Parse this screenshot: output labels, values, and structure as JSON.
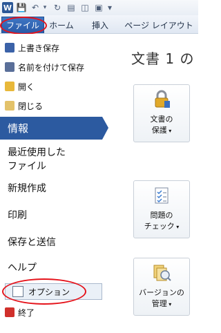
{
  "toolbar": {
    "app_icon": "W",
    "save_icon": "💾",
    "undo_icon": "↶",
    "redo_icon": "↻",
    "extra_icon": "▾"
  },
  "tabs": {
    "file": "ファイル",
    "home": "ホーム",
    "insert": "挿入",
    "page_layout": "ページ レイアウト"
  },
  "menu": {
    "overwrite_save": "上書き保存",
    "save_as": "名前を付けて保存",
    "open": "開く",
    "close": "閉じる",
    "info": "情報",
    "recent_line1": "最近使用した",
    "recent_line2": "ファイル",
    "new": "新規作成",
    "print": "印刷",
    "save_send": "保存と送信",
    "help": "ヘルプ",
    "options": "オプション",
    "exit": "終了"
  },
  "pane": {
    "title": "文書 1 の",
    "protect_line1": "文書の",
    "protect_line2": "保護",
    "check_line1": "問題の",
    "check_line2": "チェック",
    "version_line1": "バージョンの",
    "version_line2": "管理"
  },
  "colors": {
    "accent": "#2c5aa0",
    "highlight": "#e5131b"
  }
}
